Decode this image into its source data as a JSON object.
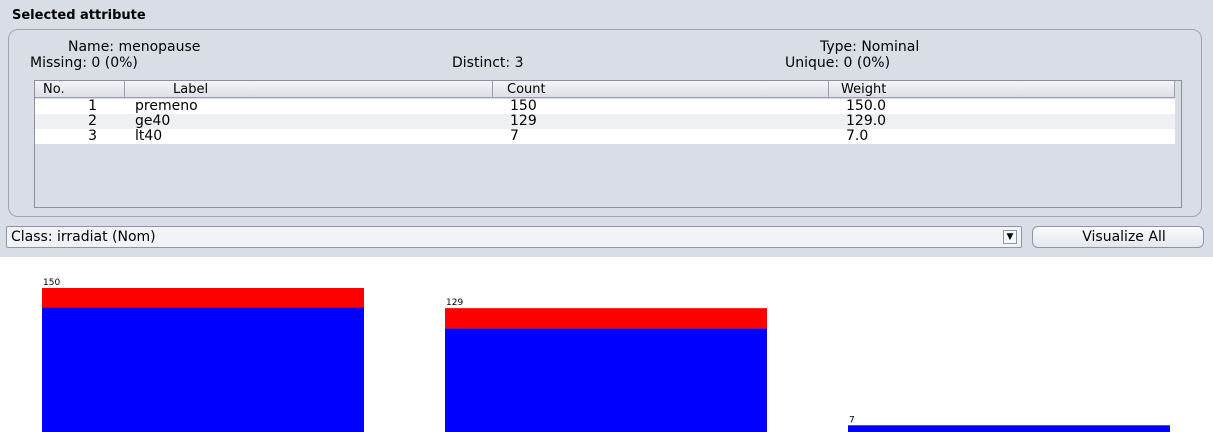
{
  "selected_attribute": {
    "title": "Selected attribute",
    "name": "Name:  menopause",
    "missing": "Missing:  0 (0%)",
    "distinct": "Distinct:  3",
    "type": "Type:  Nominal",
    "unique": "Unique:  0 (0%)"
  },
  "table": {
    "headers": [
      "No.",
      "Label",
      "Count",
      "Weight"
    ],
    "rows": [
      {
        "no": "1",
        "label": "premeno",
        "count": "150",
        "weight": "150.0"
      },
      {
        "no": "2",
        "label": "ge40",
        "count": "129",
        "weight": "129.0"
      },
      {
        "no": "3",
        "label": "lt40",
        "count": "7",
        "weight": "7.0"
      }
    ]
  },
  "class_selector": {
    "value": "Class: irradiat (Nom)",
    "arrow_icon": "▼"
  },
  "visualize_button": {
    "label": "Visualize All"
  },
  "chart_data": {
    "type": "bar",
    "stacked": true,
    "categories": [
      "premeno",
      "ge40",
      "lt40"
    ],
    "totals": [
      150,
      129,
      7
    ],
    "data_labels": [
      "150",
      "129",
      "7"
    ],
    "series": [
      {
        "values": [
          130,
          108,
          7
        ],
        "color": "#0000ff"
      },
      {
        "values": [
          20,
          21,
          0
        ],
        "color": "#ff0000"
      }
    ],
    "ylim": [
      0,
      150
    ]
  }
}
